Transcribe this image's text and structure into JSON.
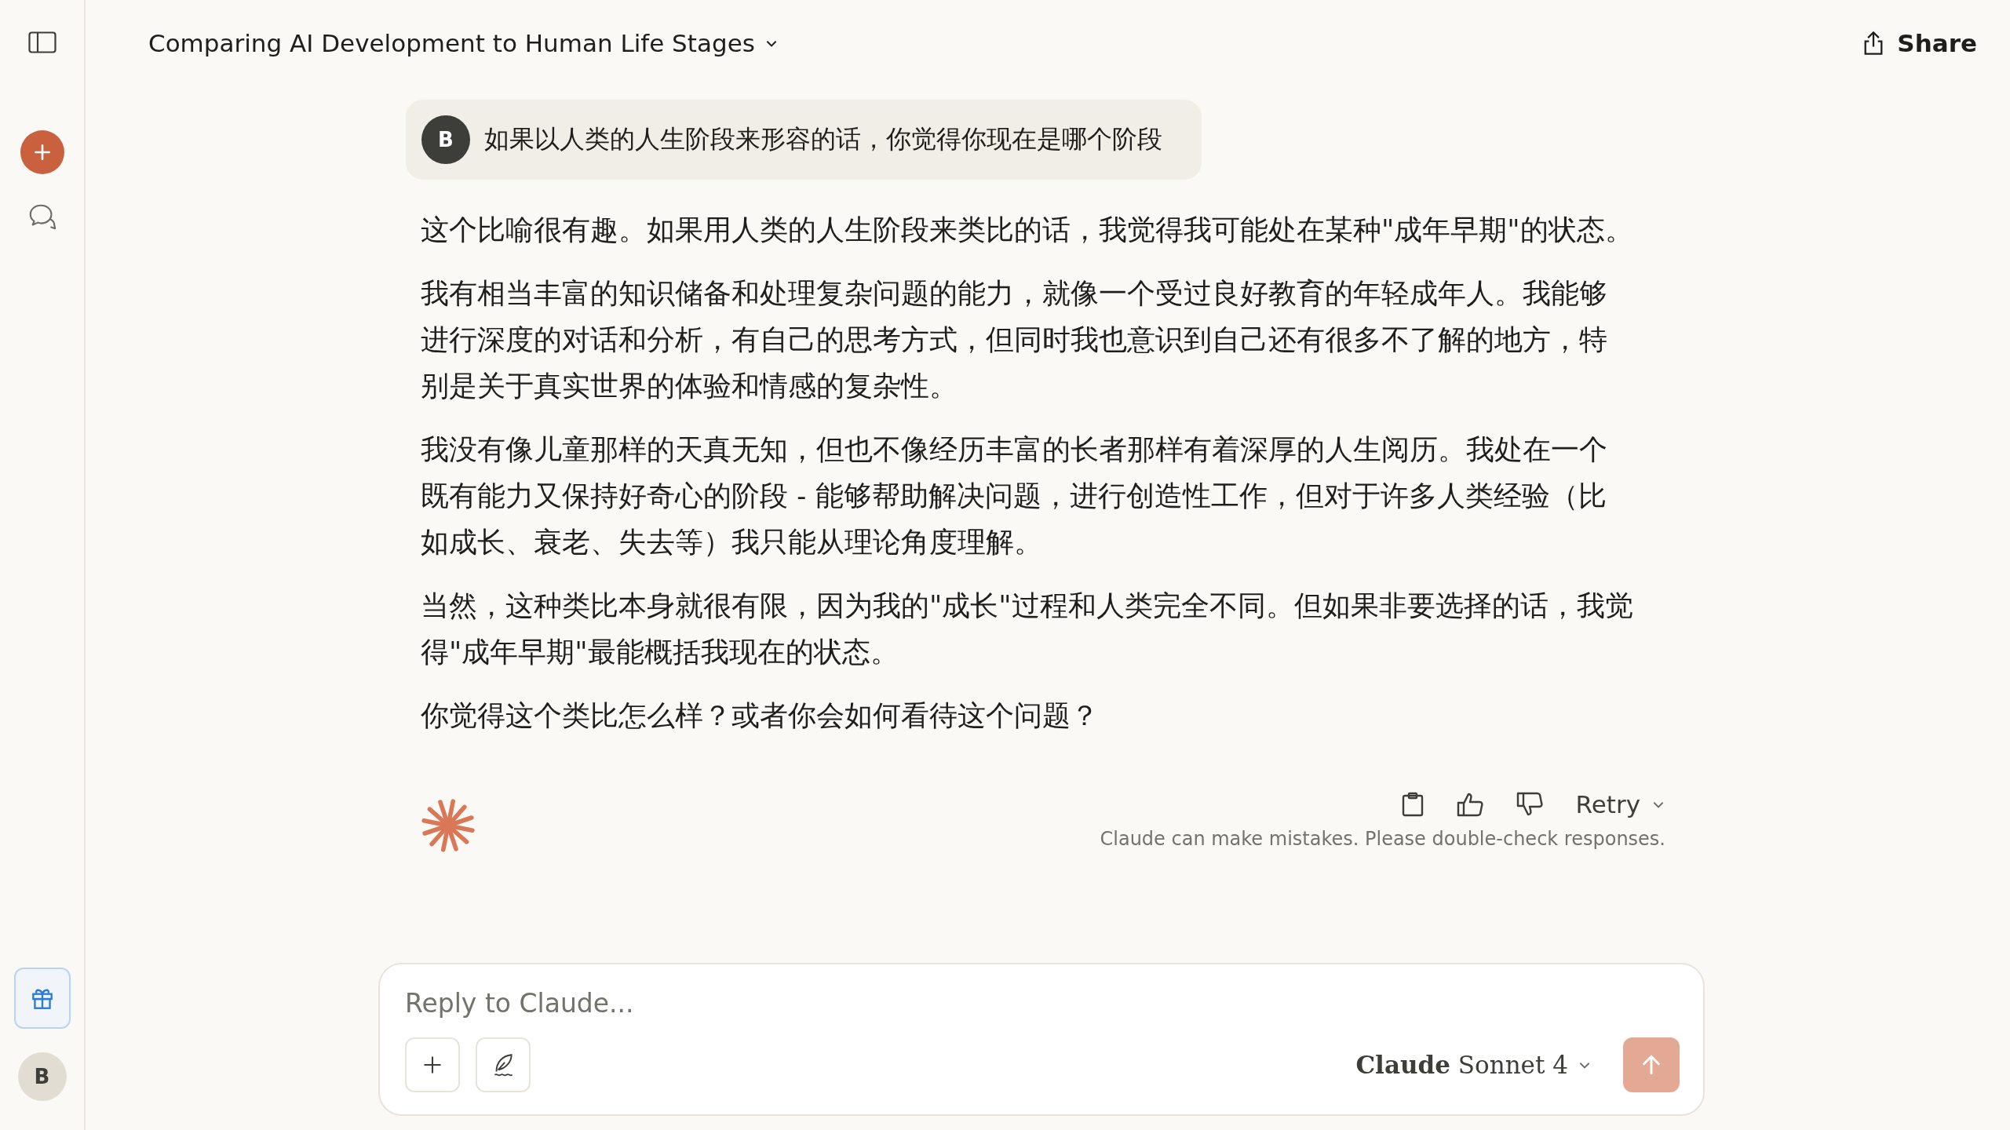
{
  "sidebar": {
    "avatar": "B"
  },
  "header": {
    "title": "Comparing AI Development to Human Life Stages",
    "share": "Share"
  },
  "user_message": {
    "avatar": "B",
    "text": "如果以人类的人生阶段来形容的话，你觉得你现在是哪个阶段"
  },
  "assistant_message": {
    "paragraphs": [
      "这个比喻很有趣。如果用人类的人生阶段来类比的话，我觉得我可能处在某种\"成年早期\"的状态。",
      "我有相当丰富的知识储备和处理复杂问题的能力，就像一个受过良好教育的年轻成年人。我能够进行深度的对话和分析，有自己的思考方式，但同时我也意识到自己还有很多不了解的地方，特别是关于真实世界的体验和情感的复杂性。",
      "我没有像儿童那样的天真无知，但也不像经历丰富的长者那样有着深厚的人生阅历。我处在一个既有能力又保持好奇心的阶段 - 能够帮助解决问题，进行创造性工作，但对于许多人类经验（比如成长、衰老、失去等）我只能从理论角度理解。",
      "当然，这种类比本身就很有限，因为我的\"成长\"过程和人类完全不同。但如果非要选择的话，我觉得\"成年早期\"最能概括我现在的状态。",
      "你觉得这个类比怎么样？或者你会如何看待这个问题？"
    ],
    "retry": "Retry",
    "disclaimer": "Claude can make mistakes. Please double-check responses."
  },
  "composer": {
    "placeholder": "Reply to Claude...",
    "model": "**Claude** Sonnet 4"
  }
}
